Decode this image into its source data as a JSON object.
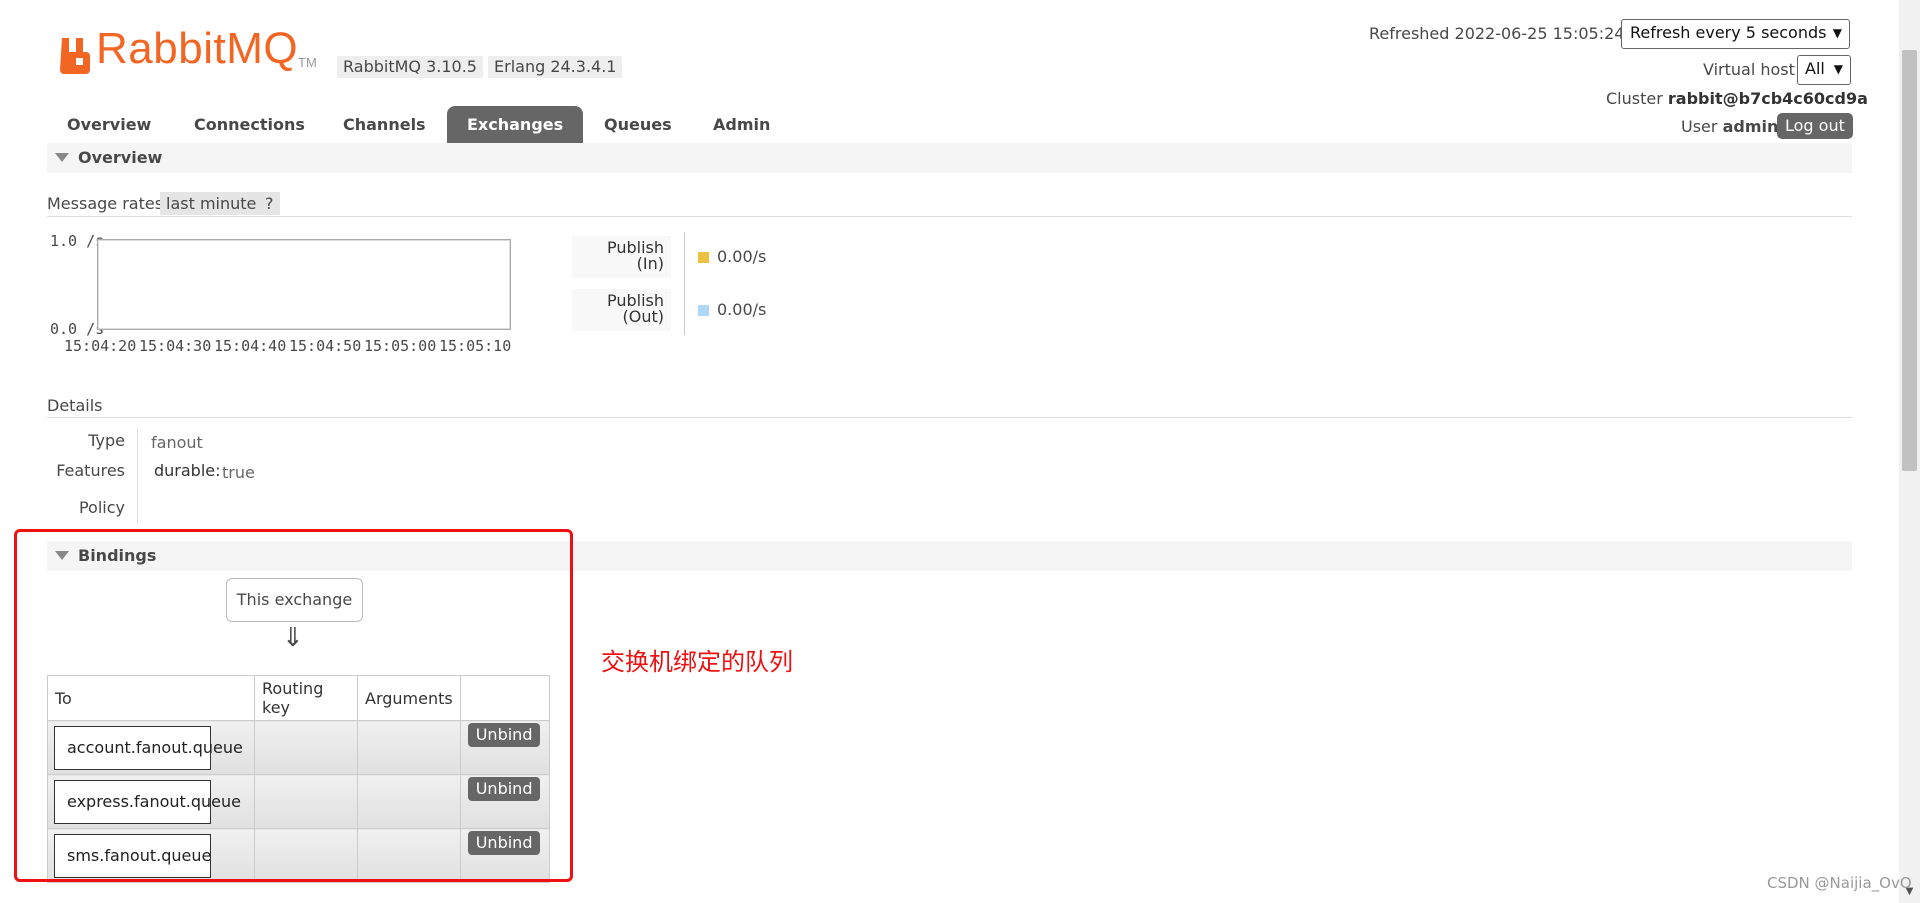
{
  "header": {
    "logo_text": "RabbitMQ",
    "logo_tm": "TM",
    "rabbitmq_version": "RabbitMQ 3.10.5",
    "erlang_version": "Erlang 24.3.4.1",
    "refreshed_text": "Refreshed 2022-06-25 15:05:24",
    "refresh_option": "Refresh every 5 seconds",
    "virtual_host_label": "Virtual host",
    "virtual_host_value": "All",
    "cluster_label": "Cluster",
    "cluster_name": "rabbit@b7cb4c60cd9a",
    "user_label": "User",
    "user_name": "admin",
    "logout_label": "Log out",
    "brand_color": "#f26522"
  },
  "tabs": [
    {
      "label": "Overview"
    },
    {
      "label": "Connections"
    },
    {
      "label": "Channels"
    },
    {
      "label": "Exchanges",
      "active": true
    },
    {
      "label": "Queues"
    },
    {
      "label": "Admin"
    }
  ],
  "overview": {
    "section_title": "Overview",
    "message_rates_label": "Message rates",
    "range_label": "last minute",
    "help_label": "?",
    "y_max": "1.0 /s",
    "y_min": "0.0 /s",
    "x_ticks": [
      "15:04:20",
      "15:04:30",
      "15:04:40",
      "15:04:50",
      "15:05:00",
      "15:05:10"
    ],
    "legend": [
      {
        "label_line1": "Publish",
        "label_line2": "(In)",
        "value": "0.00/s",
        "color": "#edc240"
      },
      {
        "label_line1": "Publish",
        "label_line2": "(Out)",
        "value": "0.00/s",
        "color": "#afd8f8"
      }
    ]
  },
  "details": {
    "label": "Details",
    "type_key": "Type",
    "type_value": "fanout",
    "features_key": "Features",
    "features_name": "durable:",
    "features_value": "true",
    "policy_key": "Policy"
  },
  "bindings": {
    "section_title": "Bindings",
    "this_exchange": "This exchange",
    "arrow": "⇓",
    "columns": [
      "To",
      "Routing key",
      "Arguments",
      ""
    ],
    "rows": [
      {
        "to": "account.fanout.queue",
        "routing_key": "",
        "arguments": "",
        "action": "Unbind"
      },
      {
        "to": "express.fanout.queue",
        "routing_key": "",
        "arguments": "",
        "action": "Unbind"
      },
      {
        "to": "sms.fanout.queue",
        "routing_key": "",
        "arguments": "",
        "action": "Unbind"
      }
    ]
  },
  "annotation": {
    "text": "交换机绑定的队列",
    "color": "#ee1111"
  },
  "watermark": "CSDN @Naijia_OvO"
}
